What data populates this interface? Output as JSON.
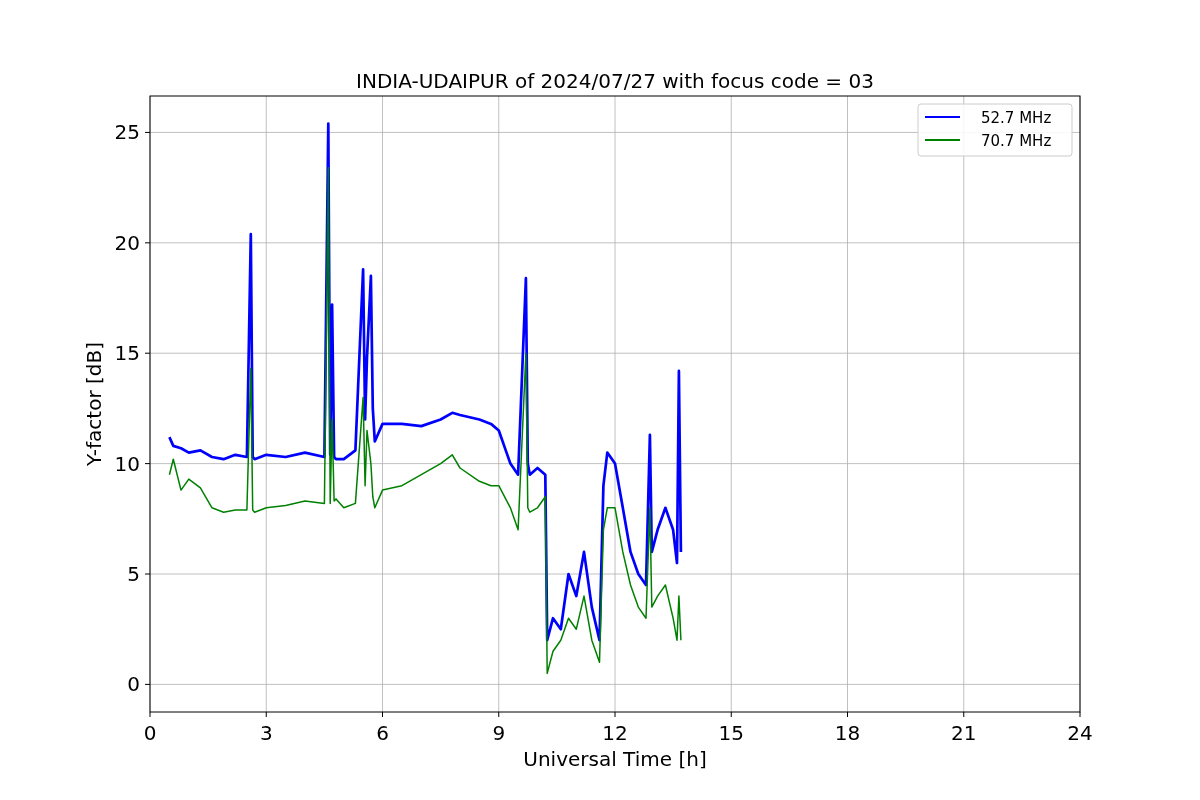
{
  "chart_data": {
    "type": "line",
    "title": "INDIA-UDAIPUR of 2024/07/27 with focus code = 03",
    "xlabel": "Universal Time [h]",
    "ylabel": "Y-factor [dB]",
    "x": [
      0.5,
      0.6,
      0.8,
      1.0,
      1.3,
      1.6,
      1.9,
      2.2,
      2.5,
      2.6,
      2.65,
      2.7,
      3.0,
      3.5,
      4.0,
      4.5,
      4.6,
      4.65,
      4.7,
      4.75,
      4.8,
      5.0,
      5.3,
      5.5,
      5.55,
      5.6,
      5.7,
      5.75,
      5.8,
      6.0,
      6.5,
      7.0,
      7.5,
      7.8,
      8.0,
      8.5,
      8.8,
      9.0,
      9.3,
      9.5,
      9.7,
      9.75,
      9.8,
      10.0,
      10.2,
      10.25,
      10.4,
      10.6,
      10.8,
      11.0,
      11.2,
      11.4,
      11.6,
      11.7,
      11.8,
      12.0,
      12.2,
      12.4,
      12.6,
      12.8,
      12.9,
      12.95,
      13.1,
      13.3,
      13.5,
      13.6,
      13.65,
      13.7
    ],
    "series": [
      {
        "name": "52.7 MHz",
        "color": "#0000ff",
        "values": [
          11.2,
          10.8,
          10.7,
          10.5,
          10.6,
          10.3,
          10.2,
          10.4,
          10.3,
          20.4,
          10.3,
          10.2,
          10.4,
          10.3,
          10.5,
          10.3,
          25.4,
          10.4,
          17.2,
          10.3,
          10.2,
          10.2,
          10.6,
          18.8,
          12.0,
          14.8,
          18.5,
          12.5,
          11.0,
          11.8,
          11.8,
          11.7,
          12.0,
          12.3,
          12.2,
          12.0,
          11.8,
          11.5,
          10.0,
          9.5,
          18.4,
          10.0,
          9.5,
          9.8,
          9.5,
          2.0,
          3.0,
          2.5,
          5.0,
          4.0,
          6.0,
          3.5,
          2.0,
          9.0,
          10.5,
          10.0,
          8.0,
          6.0,
          5.0,
          4.5,
          11.3,
          6.0,
          7.0,
          8.0,
          7.0,
          5.5,
          14.2,
          6.0
        ]
      },
      {
        "name": "70.7 MHz",
        "color": "#008000",
        "values": [
          9.5,
          10.2,
          8.8,
          9.3,
          8.9,
          8.0,
          7.8,
          7.9,
          7.9,
          14.3,
          7.9,
          7.8,
          8.0,
          8.1,
          8.3,
          8.2,
          23.4,
          8.2,
          12.0,
          8.3,
          8.4,
          8.0,
          8.2,
          13.0,
          9.0,
          11.5,
          10.0,
          8.5,
          8.0,
          8.8,
          9.0,
          9.5,
          10.0,
          10.4,
          9.8,
          9.2,
          9.0,
          9.0,
          8.0,
          7.0,
          15.0,
          8.0,
          7.8,
          8.0,
          8.5,
          0.5,
          1.5,
          2.0,
          3.0,
          2.5,
          4.0,
          2.0,
          1.0,
          7.0,
          8.0,
          8.0,
          6.0,
          4.5,
          3.5,
          3.0,
          8.0,
          3.5,
          4.0,
          4.5,
          3.0,
          2.0,
          4.0,
          2.0
        ]
      }
    ],
    "grid": true,
    "legend": true,
    "xlim": [
      0,
      24
    ],
    "ylim": [
      -1.25,
      26.65
    ],
    "xticks": [
      0,
      3,
      6,
      9,
      12,
      15,
      18,
      21,
      24
    ],
    "yticks": [
      0,
      5,
      10,
      15,
      20,
      25
    ]
  }
}
